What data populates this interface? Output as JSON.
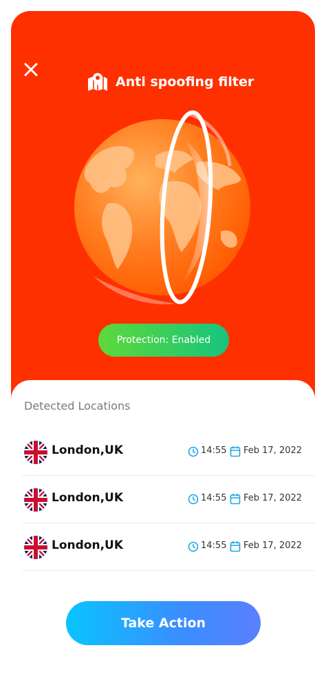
{
  "header": {
    "title": "Anti spoofing filter",
    "close_icon": "close-icon",
    "title_icon": "map-pin-icon"
  },
  "status_badge": {
    "label": "Protection: Enabled"
  },
  "locations": {
    "heading": "Detected Locations",
    "items": [
      {
        "city": "London,UK",
        "time": "14:55",
        "date": "Feb 17, 2022",
        "flag": "uk-flag-icon"
      },
      {
        "city": "London,UK",
        "time": "14:55",
        "date": "Feb 17, 2022",
        "flag": "uk-flag-icon"
      },
      {
        "city": "London,UK",
        "time": "14:55",
        "date": "Feb 17, 2022",
        "flag": "uk-flag-icon"
      }
    ]
  },
  "actions": {
    "take_action_label": "Take Action"
  },
  "colors": {
    "hero_bg": "#ff3000",
    "badge_start": "#5fd83a",
    "badge_end": "#16c47e",
    "cta_start": "#09c4ff",
    "cta_end": "#5a7fff",
    "icon_blue": "#1aa7e8"
  }
}
